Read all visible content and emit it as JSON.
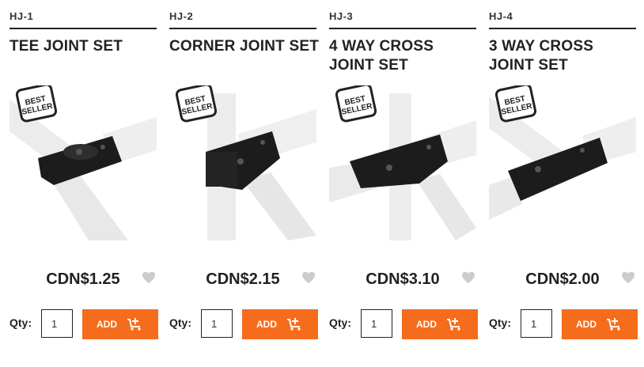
{
  "products": [
    {
      "sku": "HJ-1",
      "name": "TEE JOINT SET",
      "badge": [
        "BEST",
        "SELLER"
      ],
      "price": "CDN$1.25",
      "qty_label": "Qty:",
      "qty_value": "1",
      "add_label": "ADD"
    },
    {
      "sku": "HJ-2",
      "name": "CORNER JOINT SET",
      "badge": [
        "BEST",
        "SELLER"
      ],
      "price": "CDN$2.15",
      "qty_label": "Qty:",
      "qty_value": "1",
      "add_label": "ADD"
    },
    {
      "sku": "HJ-3",
      "name": "4 WAY CROSS JOINT SET",
      "badge": [
        "BEST",
        "SELLER"
      ],
      "price": "CDN$3.10",
      "qty_label": "Qty:",
      "qty_value": "1",
      "add_label": "ADD"
    },
    {
      "sku": "HJ-4",
      "name": "3 WAY CROSS JOINT SET",
      "badge": [
        "BEST",
        "SELLER"
      ],
      "price": "CDN$2.00",
      "qty_label": "Qty:",
      "qty_value": "1",
      "add_label": "ADD"
    }
  ],
  "colors": {
    "accent": "#f56c1d",
    "heart": "#cccccc",
    "text": "#222222"
  },
  "icons": {
    "wishlist": "heart-icon",
    "cart": "cart-add-icon"
  }
}
